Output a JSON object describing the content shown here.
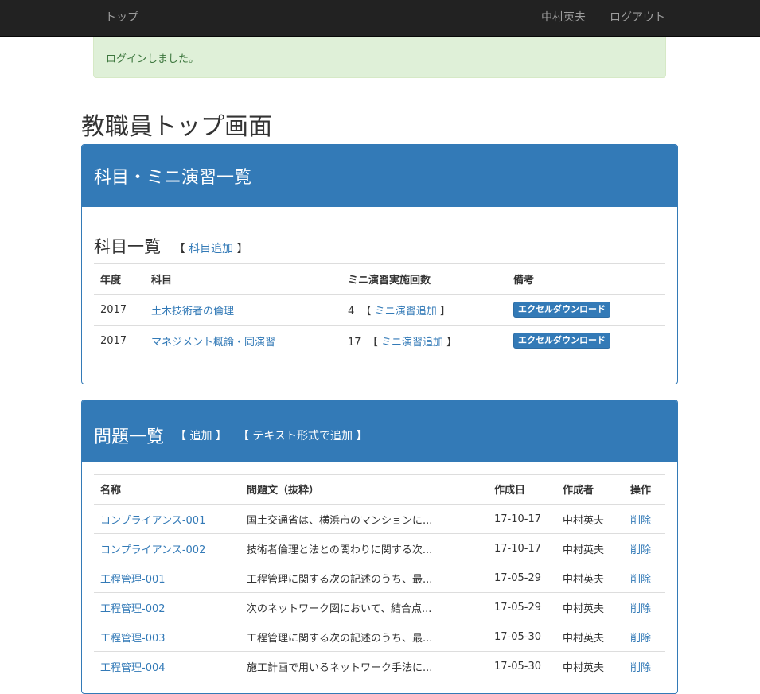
{
  "navbar": {
    "home": "トップ",
    "user_name": "中村英夫",
    "logout": "ログアウト"
  },
  "alert": {
    "message": "ログインしました。"
  },
  "page_title": "教職員トップ画面",
  "courses_panel": {
    "heading": "科目・ミニ演習一覧",
    "section_title": "科目一覧",
    "add_course": "科目追加",
    "columns": [
      "年度",
      "科目",
      "ミニ演習実施回数",
      "備考"
    ],
    "rows": [
      {
        "year": "2017",
        "course": "土木技術者の倫理",
        "count": "4",
        "add_exercise": "ミニ演習追加",
        "download": "エクセルダウンロード"
      },
      {
        "year": "2017",
        "course": "マネジメント概論・同演習",
        "count": "17",
        "add_exercise": "ミニ演習追加",
        "download": "エクセルダウンロード"
      }
    ]
  },
  "problems_panel": {
    "heading": "問題一覧",
    "add": "追加",
    "add_text": "テキスト形式で追加",
    "columns": [
      "名称",
      "問題文（抜粋）",
      "作成日",
      "作成者",
      "操作"
    ],
    "rows": [
      {
        "name": "コンプライアンス-001",
        "excerpt": "国土交通省は、横浜市のマンションに...",
        "date": "17-10-17",
        "author": "中村英夫",
        "action": "削除"
      },
      {
        "name": "コンプライアンス-002",
        "excerpt": "技術者倫理と法との関わりに関する次...",
        "date": "17-10-17",
        "author": "中村英夫",
        "action": "削除"
      },
      {
        "name": "工程管理-001",
        "excerpt": "工程管理に関する次の記述のうち、最...",
        "date": "17-05-29",
        "author": "中村英夫",
        "action": "削除"
      },
      {
        "name": "工程管理-002",
        "excerpt": "次のネットワーク図において、結合点...",
        "date": "17-05-29",
        "author": "中村英夫",
        "action": "削除"
      },
      {
        "name": "工程管理-003",
        "excerpt": "工程管理に関する次の記述のうち、最...",
        "date": "17-05-30",
        "author": "中村英夫",
        "action": "削除"
      },
      {
        "name": "工程管理-004",
        "excerpt": "施工計画で用いるネットワーク手法に...",
        "date": "17-05-30",
        "author": "中村英夫",
        "action": "削除"
      }
    ]
  }
}
